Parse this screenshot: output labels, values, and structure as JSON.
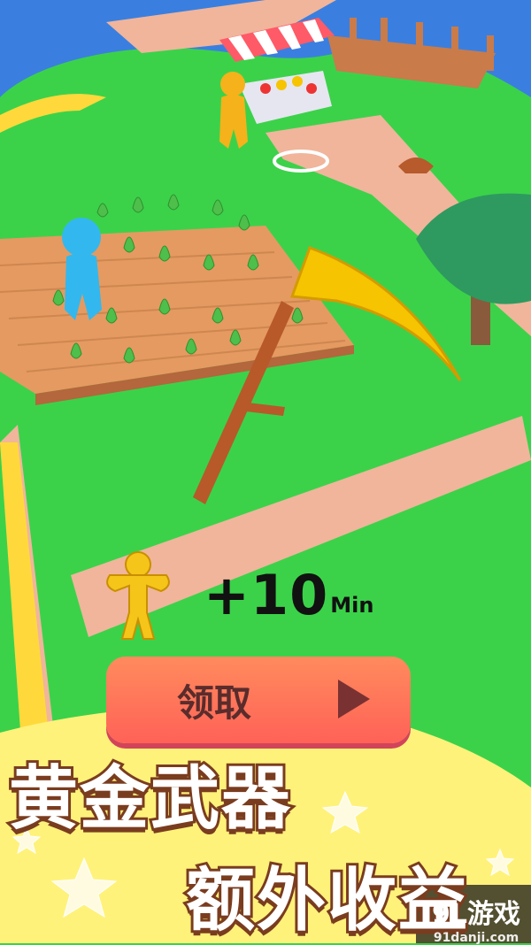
{
  "reward": {
    "amount": "+10",
    "unit": "Min"
  },
  "claim_button": {
    "label": "领取"
  },
  "promo": {
    "line1": "黄金武器",
    "line2": "额外收益"
  },
  "watermark": {
    "brand": "9L游戏",
    "site": "91danji.com"
  },
  "colors": {
    "grass": "#3bd24a",
    "path": "#f0b59b",
    "soil": "#e59a61",
    "scythe_gold": "#f6c400",
    "banner_yellow": "#fff27a",
    "button": "#ff6d5a"
  }
}
